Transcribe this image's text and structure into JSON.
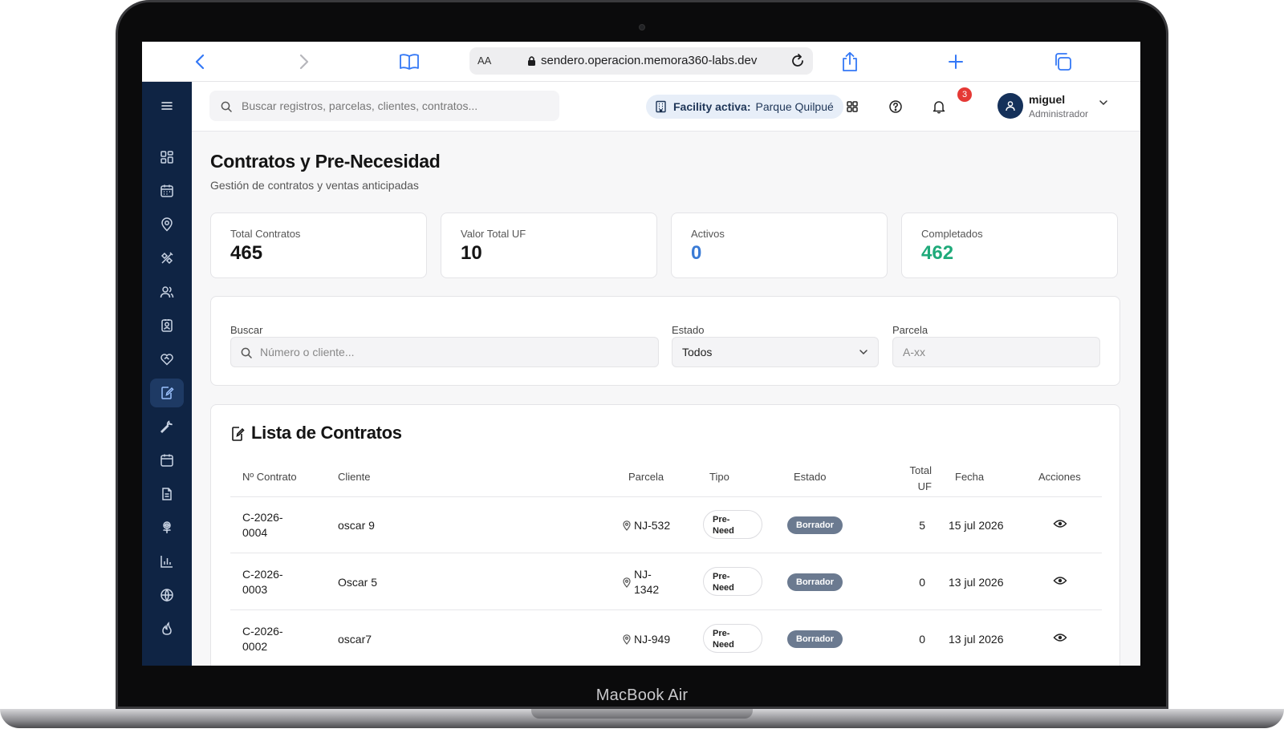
{
  "device": {
    "brand": "MacBook Air"
  },
  "browser": {
    "aa_label": "AA",
    "url": "sendero.operacion.memora360-labs.dev"
  },
  "topbar": {
    "search_placeholder": "Buscar registros, parcelas, clientes, contratos...",
    "facility_label": "Facility activa:",
    "facility_value": "Parque Quilpué",
    "notifications_count": "3",
    "user_name": "miguel",
    "user_role": "Administrador"
  },
  "page": {
    "title": "Contratos y Pre-Necesidad",
    "subtitle": "Gestión de contratos y ventas anticipadas"
  },
  "stats": [
    {
      "label": "Total Contratos",
      "value": "465",
      "color": "#141414"
    },
    {
      "label": "Valor Total UF",
      "value": "10",
      "color": "#141414"
    },
    {
      "label": "Activos",
      "value": "0",
      "color": "#3a7bd5"
    },
    {
      "label": "Completados",
      "value": "462",
      "color": "#1faa7a"
    }
  ],
  "filters": {
    "search_label": "Buscar",
    "search_placeholder": "Número o cliente...",
    "status_label": "Estado",
    "status_value": "Todos",
    "plot_label": "Parcela",
    "plot_placeholder": "A-xx"
  },
  "table": {
    "title": "Lista de Contratos",
    "headers": {
      "number": "Nº Contrato",
      "client": "Cliente",
      "plot": "Parcela",
      "type": "Tipo",
      "status": "Estado",
      "total_line1": "Total",
      "total_line2": "UF",
      "date": "Fecha",
      "actions": "Acciones"
    },
    "rows": [
      {
        "number_a": "C-2026-",
        "number_b": "0004",
        "client": "oscar 9",
        "plot_a": "NJ-532",
        "plot_b": "",
        "type_a": "Pre-",
        "type_b": "Need",
        "status": "Borrador",
        "total": "5",
        "date": "15 jul 2026"
      },
      {
        "number_a": "C-2026-",
        "number_b": "0003",
        "client": "Oscar 5",
        "plot_a": "NJ-",
        "plot_b": "1342",
        "type_a": "Pre-",
        "type_b": "Need",
        "status": "Borrador",
        "total": "0",
        "date": "13 jul 2026"
      },
      {
        "number_a": "C-2026-",
        "number_b": "0002",
        "client": "oscar7",
        "plot_a": "NJ-949",
        "plot_b": "",
        "type_a": "Pre-",
        "type_b": "Need",
        "status": "Borrador",
        "total": "0",
        "date": "13 jul 2026"
      }
    ]
  }
}
